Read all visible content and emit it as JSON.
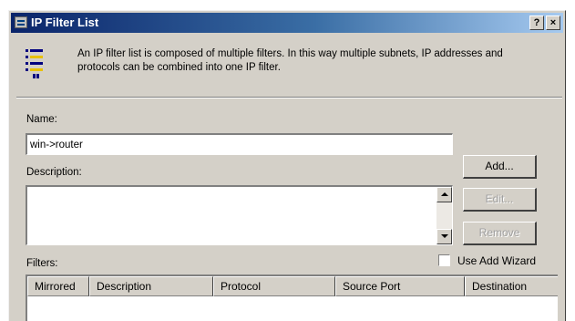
{
  "window": {
    "title": "IP Filter List",
    "help_label": "?",
    "close_label": "×"
  },
  "info": {
    "text": "An IP filter list is composed of multiple filters. In this way multiple subnets, IP addresses and protocols can be combined into one IP filter."
  },
  "name_label": "Name:",
  "name_value": "win->router",
  "description_label": "Description:",
  "buttons": {
    "add": "Add...",
    "edit": "Edit...",
    "remove": "Remove"
  },
  "filters_label": "Filters:",
  "use_add_wizard": {
    "label": "Use Add Wizard",
    "checked": false
  },
  "columns": [
    "Mirrored",
    "Description",
    "Protocol",
    "Source Port",
    "Destination"
  ]
}
